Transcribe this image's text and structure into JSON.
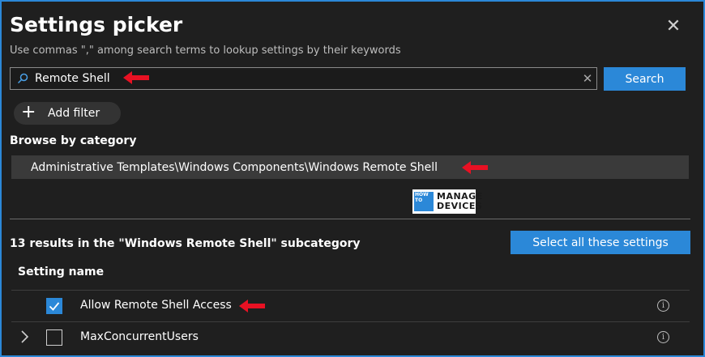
{
  "header": {
    "title": "Settings picker",
    "subtitle": "Use commas \",\" among search terms to lookup settings by their keywords",
    "close_icon": "close-icon"
  },
  "search": {
    "value": "Remote Shell",
    "button_label": "Search",
    "icon": "search-icon",
    "clear_icon": "clear-icon"
  },
  "filter": {
    "add_label": "Add filter",
    "icon": "plus-icon"
  },
  "browse": {
    "label": "Browse by category",
    "category_path": "Administrative Templates\\Windows Components\\Windows Remote Shell"
  },
  "logo": {
    "how": "HOW TO",
    "manage": "MANAGE",
    "devices": "DEVICES"
  },
  "results": {
    "summary": "13 results in the \"Windows Remote Shell\" subcategory",
    "select_all_label": "Select all these settings",
    "column_header": "Setting name",
    "rows": [
      {
        "label": "Allow Remote Shell Access",
        "checked": true,
        "expandable": false
      },
      {
        "label": "MaxConcurrentUsers",
        "checked": false,
        "expandable": true
      }
    ]
  },
  "colors": {
    "accent": "#2b88d8",
    "background": "#1f1f1f",
    "annotation_arrow": "#e81123"
  }
}
